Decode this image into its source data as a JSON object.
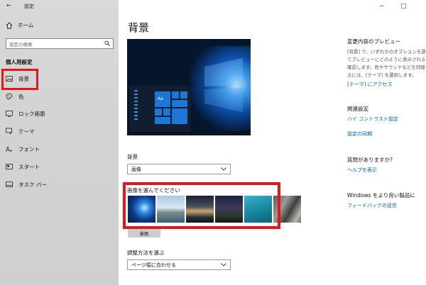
{
  "titlebar": {
    "back_glyph": "←",
    "title": "設定",
    "minimize_glyph": "−",
    "maximize_glyph": "□"
  },
  "sidebar": {
    "home_label": "ホーム",
    "search_placeholder": "設定の検索",
    "section_title": "個人用設定",
    "items": [
      {
        "label": "背景",
        "icon": "picture-icon",
        "selected": true
      },
      {
        "label": "色",
        "icon": "palette-icon"
      },
      {
        "label": "ロック画面",
        "icon": "lock-screen-icon"
      },
      {
        "label": "テーマ",
        "icon": "theme-brush-icon"
      },
      {
        "label": "フォント",
        "icon": "font-icon"
      },
      {
        "label": "スタート",
        "icon": "start-icon"
      },
      {
        "label": "タスク バー",
        "icon": "taskbar-icon"
      }
    ]
  },
  "main": {
    "title": "背景",
    "preview_tile_text": "Aa",
    "background_label": "背景",
    "background_value": "画像",
    "choose_picture_label": "画像を選んでください",
    "thumbnails": [
      "thumbnail-windows-hero",
      "thumbnail-coast-sky",
      "thumbnail-sea-rock-night",
      "thumbnail-starry-night",
      "thumbnail-underwater-swimmer",
      "thumbnail-rock-cliff"
    ],
    "browse_label": "参照",
    "fit_label": "調整方法を選ぶ",
    "fit_value": "ページ幅に合わせる"
  },
  "right_panel": {
    "preview_title": "変更内容のプレビュー",
    "preview_lines": [
      "[背景] で、いずれかのオプションを選",
      "てプレビューにどのように表示されるか",
      "確認します。色やサウンドなどを同様",
      "るには、[テーマ] を選択します。"
    ],
    "preview_link": "[テーマ] にアクセス",
    "related_title": "関連設定",
    "related_links": [
      "ハイ コントラスト設定",
      "設定の同期"
    ],
    "question_title": "質問がありますか?",
    "question_link": "ヘルプを表示",
    "feedback_title": "Windows をより良い製品に",
    "feedback_link": "フィードバックの送信"
  },
  "colors": {
    "accent": "#0062b8",
    "highlight": "#e8141c"
  }
}
